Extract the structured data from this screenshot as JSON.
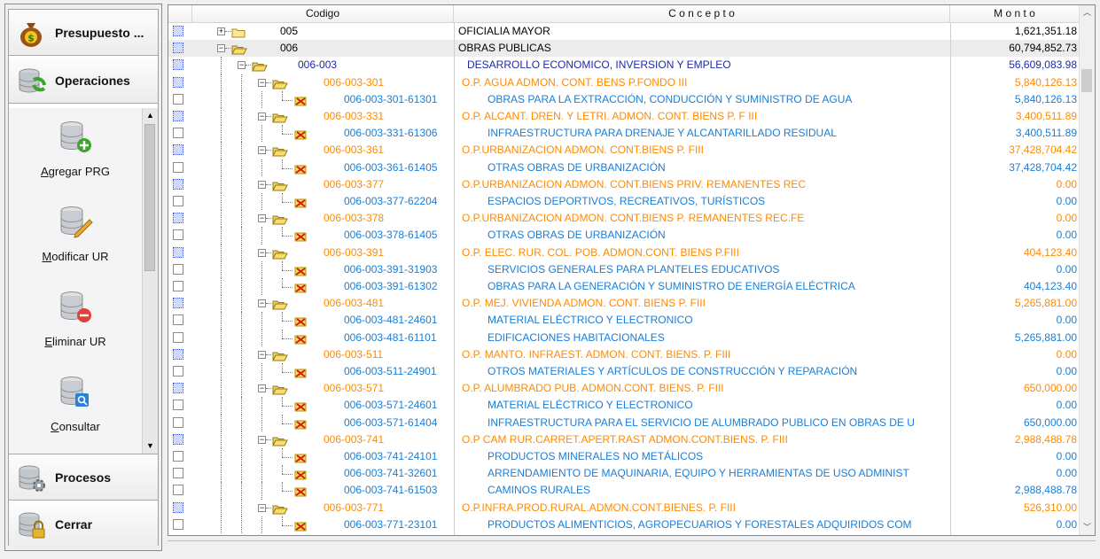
{
  "nav": {
    "buttons": [
      {
        "label": "Presupuesto ...",
        "icon": "money-bag-icon"
      },
      {
        "label": "Operaciones",
        "icon": "database-refresh-icon"
      },
      {
        "label": "Procesos",
        "icon": "database-gear-icon"
      },
      {
        "label": "Cerrar",
        "icon": "database-lock-icon"
      }
    ],
    "sub_items": [
      {
        "label": "Agregar PRG",
        "icon": "database-add-icon"
      },
      {
        "label": "Modificar UR",
        "icon": "database-edit-icon"
      },
      {
        "label": "Eliminar UR",
        "icon": "database-remove-icon"
      },
      {
        "label": "Consultar",
        "icon": "database-search-icon"
      }
    ]
  },
  "grid": {
    "columns": [
      "Codigo",
      "C o n c e p t o",
      "M o n t o"
    ],
    "rows": [
      {
        "level": 0,
        "expander": "+",
        "folder": "closed",
        "code": "005",
        "concept": "OFICIALIA MAYOR",
        "monto": "1,621,351.18",
        "checked": true
      },
      {
        "level": 0,
        "expander": "-",
        "folder": "open",
        "code": "006",
        "concept": "OBRAS PUBLICAS",
        "monto": "60,794,852.73",
        "checked": true,
        "selected": true
      },
      {
        "level": 1,
        "expander": "-",
        "folder": "open",
        "code": "006-003",
        "concept": "DESARROLLO ECONOMICO, INVERSION Y EMPLEO",
        "monto": "56,609,083.98",
        "checked": true
      },
      {
        "level": 2,
        "expander": "-",
        "folder": "open",
        "code": "006-003-301",
        "concept": "O.P. AGUA ADMON. CONT. BENS P.FONDO III",
        "monto": "5,840,126.13",
        "checked": true
      },
      {
        "level": 3,
        "expander": "",
        "folder": "leaf",
        "code": "006-003-301-61301",
        "concept": "OBRAS PARA LA EXTRACCIÓN, CONDUCCIÓN Y SUMINISTRO DE AGUA",
        "monto": "5,840,126.13",
        "checked": false
      },
      {
        "level": 2,
        "expander": "-",
        "folder": "open",
        "code": "006-003-331",
        "concept": "O.P. ALCANT. DREN. Y LETRI. ADMON. CONT. BIENS P. F III",
        "monto": "3,400,511.89",
        "checked": true
      },
      {
        "level": 3,
        "expander": "",
        "folder": "leaf",
        "code": "006-003-331-61306",
        "concept": "INFRAESTRUCTURA PARA DRENAJE Y ALCANTARILLADO RESIDUAL",
        "monto": "3,400,511.89",
        "checked": false
      },
      {
        "level": 2,
        "expander": "-",
        "folder": "open",
        "code": "006-003-361",
        "concept": "O.P.URBANIZACION ADMON. CONT.BIENS P. FIII",
        "monto": "37,428,704.42",
        "checked": true
      },
      {
        "level": 3,
        "expander": "",
        "folder": "leaf",
        "code": "006-003-361-61405",
        "concept": "OTRAS OBRAS DE URBANIZACIÓN",
        "monto": "37,428,704.42",
        "checked": false
      },
      {
        "level": 2,
        "expander": "-",
        "folder": "open",
        "code": "006-003-377",
        "concept": "O.P.URBANIZACION ADMON. CONT.BIENS PRIV. REMANENTES REC",
        "monto": "0.00",
        "checked": true
      },
      {
        "level": 3,
        "expander": "",
        "folder": "leaf",
        "code": "006-003-377-62204",
        "concept": "ESPACIOS DEPORTIVOS, RECREATIVOS, TURÍSTICOS",
        "monto": "0.00",
        "checked": false
      },
      {
        "level": 2,
        "expander": "-",
        "folder": "open",
        "code": "006-003-378",
        "concept": "O.P.URBANIZACION ADMON. CONT.BIENS P. REMANENTES REC.FE",
        "monto": "0.00",
        "checked": true
      },
      {
        "level": 3,
        "expander": "",
        "folder": "leaf",
        "code": "006-003-378-61405",
        "concept": "OTRAS OBRAS DE URBANIZACIÓN",
        "monto": "0.00",
        "checked": false
      },
      {
        "level": 2,
        "expander": "-",
        "folder": "open",
        "code": "006-003-391",
        "concept": "O.P. ELEC. RUR. COL. POB. ADMON.CONT. BIENS P.FIII",
        "monto": "404,123.40",
        "checked": true
      },
      {
        "level": 3,
        "expander": "",
        "folder": "leaf",
        "code": "006-003-391-31903",
        "concept": "SERVICIOS GENERALES PARA PLANTELES EDUCATIVOS",
        "monto": "0.00",
        "checked": false
      },
      {
        "level": 3,
        "expander": "",
        "folder": "leaf",
        "code": "006-003-391-61302",
        "concept": "OBRAS PARA LA GENERACIÓN Y SUMINISTRO DE ENERGÍA ELÉCTRICA",
        "monto": "404,123.40",
        "checked": false
      },
      {
        "level": 2,
        "expander": "-",
        "folder": "open",
        "code": "006-003-481",
        "concept": "O.P. MEJ. VIVIENDA ADMON. CONT. BIENS P. FIII",
        "monto": "5,265,881.00",
        "checked": true
      },
      {
        "level": 3,
        "expander": "",
        "folder": "leaf",
        "code": "006-003-481-24601",
        "concept": "MATERIAL ELÉCTRICO Y ELECTRONICO",
        "monto": "0.00",
        "checked": false
      },
      {
        "level": 3,
        "expander": "",
        "folder": "leaf",
        "code": "006-003-481-61101",
        "concept": "EDIFICACIONES HABITACIONALES",
        "monto": "5,265,881.00",
        "checked": false
      },
      {
        "level": 2,
        "expander": "-",
        "folder": "open",
        "code": "006-003-511",
        "concept": "O.P. MANTO. INFRAEST. ADMON. CONT. BIENS. P. FIII",
        "monto": "0.00",
        "checked": true
      },
      {
        "level": 3,
        "expander": "",
        "folder": "leaf",
        "code": "006-003-511-24901",
        "concept": "OTROS MATERIALES Y ARTÍCULOS DE CONSTRUCCIÓN Y REPARACIÓN",
        "monto": "0.00",
        "checked": false
      },
      {
        "level": 2,
        "expander": "-",
        "folder": "open",
        "code": "006-003-571",
        "concept": "O.P. ALUMBRADO PUB. ADMON.CONT. BIENS. P. FIII",
        "monto": "650,000.00",
        "checked": true
      },
      {
        "level": 3,
        "expander": "",
        "folder": "leaf",
        "code": "006-003-571-24601",
        "concept": "MATERIAL ELÉCTRICO Y ELECTRONICO",
        "monto": "0.00",
        "checked": false
      },
      {
        "level": 3,
        "expander": "",
        "folder": "leaf",
        "code": "006-003-571-61404",
        "concept": "INFRAESTRUCTURA PARA EL SERVICIO DE ALUMBRADO PUBLICO EN OBRAS DE U",
        "monto": "650,000.00",
        "checked": false
      },
      {
        "level": 2,
        "expander": "-",
        "folder": "open",
        "code": "006-003-741",
        "concept": "O.P CAM RUR.CARRET.APERT.RAST ADMON.CONT.BIENS. P. FIII",
        "monto": "2,988,488.78",
        "checked": true
      },
      {
        "level": 3,
        "expander": "",
        "folder": "leaf",
        "code": "006-003-741-24101",
        "concept": "PRODUCTOS MINERALES NO METÁLICOS",
        "monto": "0.00",
        "checked": false
      },
      {
        "level": 3,
        "expander": "",
        "folder": "leaf",
        "code": "006-003-741-32601",
        "concept": "ARRENDAMIENTO DE MAQUINARIA, EQUIPO Y HERRAMIENTAS DE USO ADMINIST",
        "monto": "0.00",
        "checked": false
      },
      {
        "level": 3,
        "expander": "",
        "folder": "leaf",
        "code": "006-003-741-61503",
        "concept": "CAMINOS RURALES",
        "monto": "2,988,488.78",
        "checked": false
      },
      {
        "level": 2,
        "expander": "-",
        "folder": "open",
        "code": "006-003-771",
        "concept": "O.P.INFRA.PROD.RURAL.ADMON.CONT.BIENES. P. FIII",
        "monto": "526,310.00",
        "checked": true
      },
      {
        "level": 3,
        "expander": "",
        "folder": "leaf",
        "code": "006-003-771-23101",
        "concept": "PRODUCTOS ALIMENTICIOS, AGROPECUARIOS Y FORESTALES ADQUIRIDOS COM",
        "monto": "0.00",
        "checked": false
      }
    ]
  }
}
